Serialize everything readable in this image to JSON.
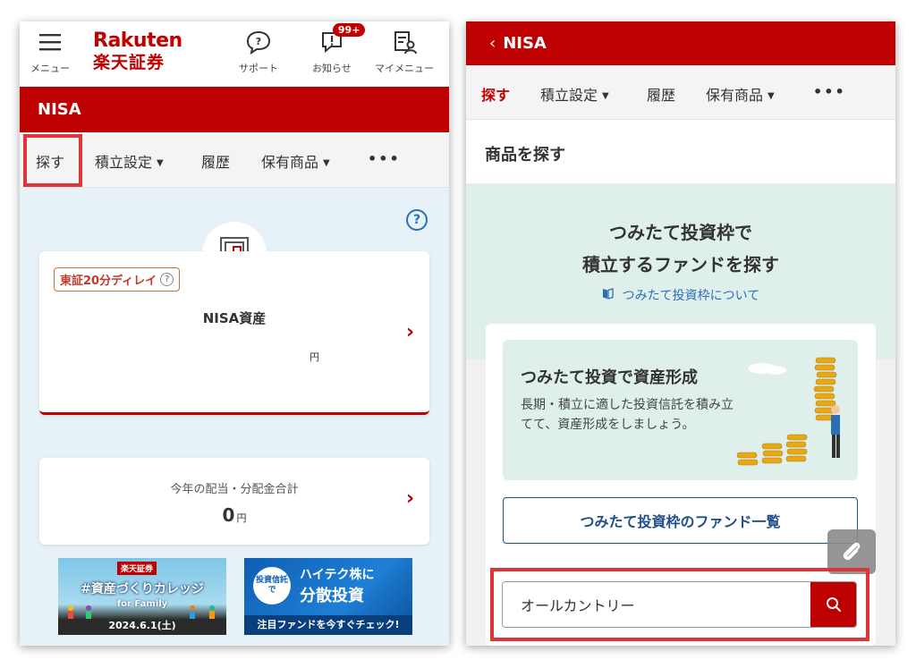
{
  "left_screen": {
    "header": {
      "menu_label": "メニュー",
      "logo_en": "Rakuten",
      "logo_jp": "楽天証券",
      "support_label": "サポート",
      "notice_label": "お知らせ",
      "notice_badge": "99+",
      "mymenu_label": "マイメニュー"
    },
    "section_title": "NISA",
    "tabs": [
      {
        "label": "探す",
        "active": false,
        "highlighted": true
      },
      {
        "label": "積立設定",
        "caret": "▼"
      },
      {
        "label": "履歴"
      },
      {
        "label": "保有商品",
        "caret": "▼"
      },
      {
        "label": "•••"
      }
    ],
    "help_glyph": "?",
    "asset_card": {
      "delay_badge": "東証20分ディレイ",
      "badge_help": "?",
      "title": "NISA資産",
      "unit": "円",
      "chevron": "›"
    },
    "dividend_card": {
      "title": "今年の配当・分配金合計",
      "value": "0",
      "unit": "円",
      "chevron": "›"
    },
    "banners": {
      "b1_tag": "楽天証券",
      "b1_main": "#資産づくりカレッジ",
      "b1_sub": "for Family",
      "b1_date": "2024.6.1(土)",
      "b2_circle": "投資信託で",
      "b2_line1": "ハイテク株に",
      "b2_line2": "分散投資",
      "b2_footer": "注目ファンドを今すぐチェック!"
    }
  },
  "right_screen": {
    "back_glyph": "‹",
    "title": "NISA",
    "tabs": [
      {
        "label": "探す",
        "active": true
      },
      {
        "label": "積立設定",
        "caret": "▼"
      },
      {
        "label": "履歴"
      },
      {
        "label": "保有商品",
        "caret": "▼"
      },
      {
        "label": "•••"
      }
    ],
    "sub_title": "商品を探す",
    "hero_line1": "つみたて投資枠で",
    "hero_line2": "積立するファンドを探す",
    "about_link": "つみたて投資枠について",
    "promo_title": "つみたて投資で資産形成",
    "promo_text": "長期・積立に適した投資信託を積み立てて、資産形成をしましょう。",
    "fund_list_button": "つみたて投資枠のファンド一覧",
    "search_value": "オールカントリー"
  },
  "colors": {
    "brand_red": "#bf0000",
    "highlight_red": "#e0343b",
    "link_blue": "#2a6fb7",
    "navy": "#1f4e8c",
    "light_blue_bg": "#e6f1f8",
    "teal_bg": "#dff0ec"
  },
  "icons": [
    "hamburger-icon",
    "support-icon",
    "notice-icon",
    "mymenu-icon",
    "help-icon",
    "safe-icon",
    "chevron-right-icon",
    "back-chevron-icon",
    "book-icon",
    "paperclip-icon",
    "search-icon"
  ]
}
